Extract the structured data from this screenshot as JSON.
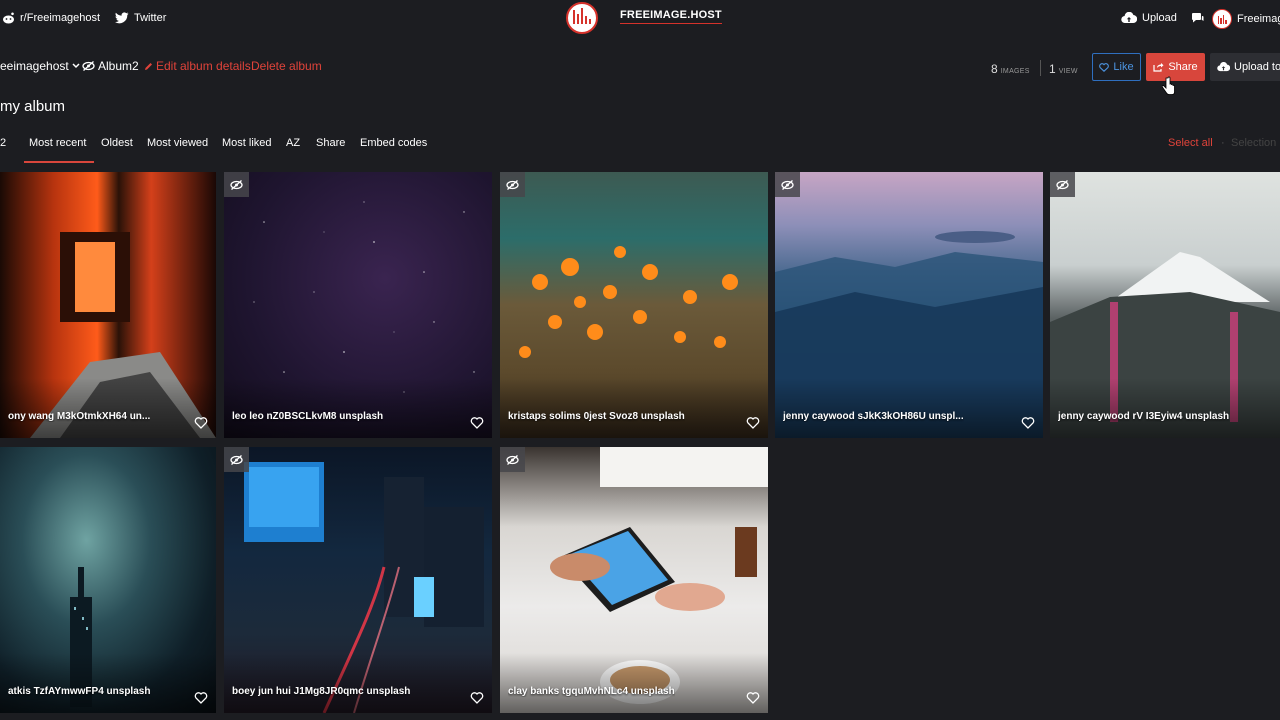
{
  "topbar": {
    "reddit_label": "r/Freeimagehost",
    "twitter_label": "Twitter",
    "logo_text": "FREEIMAGE.HOST",
    "upload_label": "Upload",
    "user_label": "Freeimag"
  },
  "albumbar": {
    "owner": "eeimagehost",
    "album_name": "Album2",
    "edit_label": "Edit album details",
    "delete_label": "Delete album",
    "images_count": "8",
    "images_label": "IMAGES",
    "views_count": "1",
    "views_label": "VIEW",
    "like_label": "Like",
    "share_label": "Share",
    "upload_to_label": "Upload to"
  },
  "album_title": "my album",
  "tabs": {
    "count": "2",
    "items": [
      "Most recent",
      "Oldest",
      "Most viewed",
      "Most liked",
      "AZ",
      "Share",
      "Embed codes"
    ],
    "select_all": "Select all",
    "selection": "Selection"
  },
  "images": [
    {
      "caption": "ony wang M3kOtmkXH64 un...",
      "private": false
    },
    {
      "caption": "leo leo nZ0BSCLkvM8 unsplash",
      "private": true
    },
    {
      "caption": "kristaps solims 0jest Svoz8 unsplash",
      "private": true
    },
    {
      "caption": "jenny caywood sJkK3kOH86U unspl...",
      "private": true
    },
    {
      "caption": "jenny caywood rV I3Eyiw4 unsplash",
      "private": true
    },
    {
      "caption": "atkis TzfAYmwwFP4 unsplash",
      "private": false
    },
    {
      "caption": "boey jun hui J1Mg8JR0qmc unsplash",
      "private": true
    },
    {
      "caption": "clay banks tgquMvhNLc4 unsplash",
      "private": true
    }
  ],
  "colors": {
    "accent": "#d8463c",
    "like": "#4c94e0",
    "background": "#1c1d21"
  }
}
